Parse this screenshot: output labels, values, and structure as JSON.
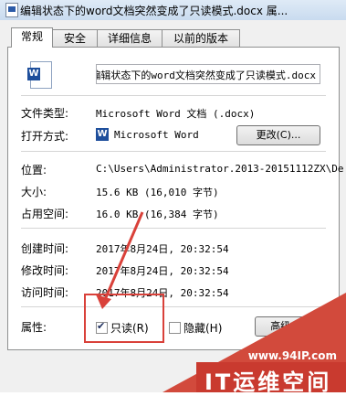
{
  "window": {
    "title": "编辑状态下的word文档突然变成了只读模式.docx 属..."
  },
  "tabs": [
    {
      "label": "常规",
      "active": true
    },
    {
      "label": "安全",
      "active": false
    },
    {
      "label": "详细信息",
      "active": false
    },
    {
      "label": "以前的版本",
      "active": false
    }
  ],
  "general": {
    "file_name": "编辑状态下的word文档突然变成了只读模式.docx",
    "file_type_label": "文件类型:",
    "file_type_value": "Microsoft Word 文档 (.docx)",
    "opens_with_label": "打开方式:",
    "opens_with_value": "Microsoft Word",
    "change_button": "更改(C)...",
    "location_label": "位置:",
    "location_value": "C:\\Users\\Administrator.2013-20151112ZX\\De",
    "size_label": "大小:",
    "size_value": "15.6 KB (16,010 字节)",
    "size_on_disk_label": "占用空间:",
    "size_on_disk_value": "16.0 KB (16,384 字节)",
    "created_label": "创建时间:",
    "created_value": "2017年8月24日, 20:32:54",
    "modified_label": "修改时间:",
    "modified_value": "2017年8月24日, 20:32:54",
    "accessed_label": "访问时间:",
    "accessed_value": "2017年8月24日, 20:32:54",
    "attributes_label": "属性:",
    "readonly_label": "只读(R)",
    "readonly_checked": true,
    "hidden_label": "隐藏(H)",
    "hidden_checked": false,
    "advanced_button": "高级(D)..."
  },
  "watermark": {
    "url": "www.94IP.com",
    "brand": "IT运维空间"
  },
  "colors": {
    "highlight": "#d9413a",
    "watermark_red": "#c93a2f"
  }
}
